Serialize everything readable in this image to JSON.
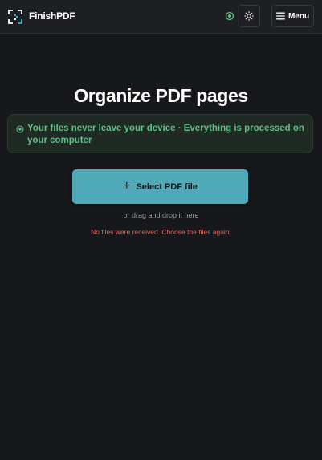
{
  "header": {
    "brand": "FinishPDF",
    "menu_label": "Menu",
    "icons": {
      "logo": "finishpdf-logo-icon",
      "status": "status-dot-icon",
      "theme": "sun-icon",
      "menu": "hamburger-icon"
    }
  },
  "main": {
    "title": "Organize PDF pages",
    "notice": "Your files never leave your device · Everything is processed on your computer",
    "select_button_label": "Select PDF file",
    "drag_hint": "or drag and drop it here",
    "error_message": "No files were received. Choose the files again."
  },
  "colors": {
    "background": "#17181b",
    "accent": "#4fa9b9",
    "notice_text": "#5fbf85",
    "error": "#e0685f"
  }
}
